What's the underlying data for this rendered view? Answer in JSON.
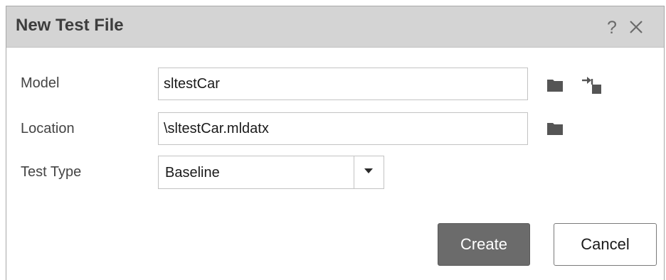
{
  "dialog": {
    "title": "New Test File",
    "help_symbol": "?",
    "close_icon": "close-icon"
  },
  "form": {
    "model": {
      "label": "Model",
      "value": "sltestCar"
    },
    "location": {
      "label": "Location",
      "value": "\\sltestCar.mldatx"
    },
    "test_type": {
      "label": "Test Type",
      "selected": "Baseline"
    }
  },
  "buttons": {
    "create_label": "Create",
    "cancel_label": "Cancel"
  },
  "icons": {
    "browse": "folder-icon",
    "open_model": "open-model-icon",
    "dropdown": "chevron-down-icon"
  },
  "colors": {
    "titlebar": "#d4d4d4",
    "primary_button": "#6b6b6b",
    "icon": "#555555"
  }
}
